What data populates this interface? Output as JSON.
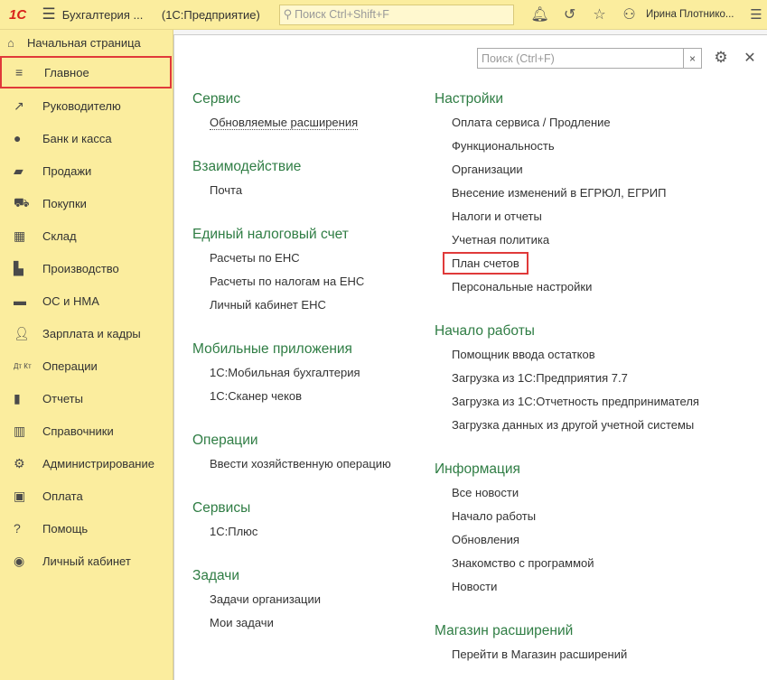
{
  "topbar": {
    "logo_text": "1С",
    "app_title": "Бухгалтерия ...",
    "app_subtitle": "(1С:Предприятие)",
    "search_placeholder": "Поиск Ctrl+Shift+F",
    "user_name": "Ирина Плотнико..."
  },
  "sidebar": {
    "home_label": "Начальная страница",
    "items": [
      {
        "label": "Главное",
        "icon": "menu-lines-icon"
      },
      {
        "label": "Руководителю",
        "icon": "trend-up-icon"
      },
      {
        "label": "Банк и касса",
        "icon": "coin-icon"
      },
      {
        "label": "Продажи",
        "icon": "bag-icon"
      },
      {
        "label": "Покупки",
        "icon": "cart-icon"
      },
      {
        "label": "Склад",
        "icon": "grid-icon"
      },
      {
        "label": "Производство",
        "icon": "factory-icon"
      },
      {
        "label": "ОС и НМА",
        "icon": "truck-icon"
      },
      {
        "label": "Зарплата и кадры",
        "icon": "person-icon"
      },
      {
        "label": "Операции",
        "icon": "dt-kt-icon"
      },
      {
        "label": "Отчеты",
        "icon": "bar-chart-icon"
      },
      {
        "label": "Справочники",
        "icon": "books-icon"
      },
      {
        "label": "Администрирование",
        "icon": "gear-icon"
      },
      {
        "label": "Оплата",
        "icon": "wallet-icon"
      },
      {
        "label": "Помощь",
        "icon": "question-icon"
      },
      {
        "label": "Личный кабинет",
        "icon": "account-icon"
      }
    ],
    "dt_kt_glyph": "Дт Кт"
  },
  "main": {
    "search_placeholder": "Поиск (Ctrl+F)",
    "clear_glyph": "×",
    "left_groups": [
      {
        "title": "Сервис",
        "links": [
          "Обновляемые расширения"
        ]
      },
      {
        "title": "Взаимодействие",
        "links": [
          "Почта"
        ]
      },
      {
        "title": "Единый налоговый счет",
        "links": [
          "Расчеты по ЕНС",
          "Расчеты по налогам на ЕНС",
          "Личный кабинет ЕНС"
        ]
      },
      {
        "title": "Мобильные приложения",
        "links": [
          "1С:Мобильная бухгалтерия",
          "1С:Сканер чеков"
        ]
      },
      {
        "title": "Операции",
        "links": [
          "Ввести хозяйственную операцию"
        ]
      },
      {
        "title": "Сервисы",
        "links": [
          "1С:Плюс"
        ]
      },
      {
        "title": "Задачи",
        "links": [
          "Задачи организации",
          "Мои задачи"
        ]
      }
    ],
    "right_groups": [
      {
        "title": "Настройки",
        "links": [
          "Оплата сервиса / Продление",
          "Функциональность",
          "Организации",
          "Внесение изменений в ЕГРЮЛ, ЕГРИП",
          "Налоги и отчеты",
          "Учетная политика",
          "План счетов",
          "Персональные настройки"
        ]
      },
      {
        "title": "Начало работы",
        "links": [
          "Помощник ввода остатков",
          "Загрузка из 1С:Предприятия 7.7",
          "Загрузка из 1С:Отчетность предпринимателя",
          "Загрузка данных из другой учетной системы"
        ]
      },
      {
        "title": "Информация",
        "links": [
          "Все новости",
          "Начало работы",
          "Обновления",
          "Знакомство с программой",
          "Новости"
        ]
      },
      {
        "title": "Магазин расширений",
        "links": [
          "Перейти в Магазин расширений"
        ]
      }
    ]
  },
  "colors": {
    "sidebar_bg": "#fbed9e",
    "group_title": "#2f7d44",
    "highlight_border": "#e03a3a"
  }
}
